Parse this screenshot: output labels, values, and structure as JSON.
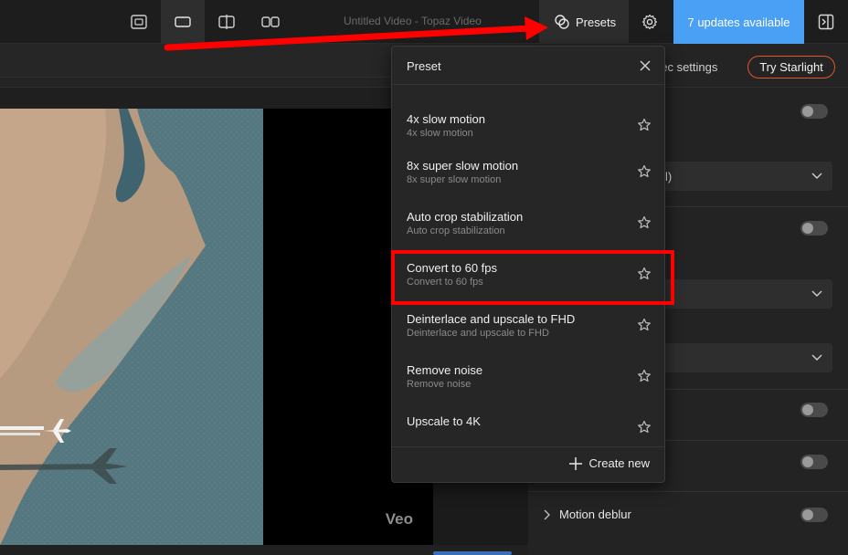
{
  "topbar": {
    "view_buttons": [
      {
        "name": "single-view-icon"
      },
      {
        "name": "fit-view-icon"
      },
      {
        "name": "split-view-icon"
      },
      {
        "name": "side-by-side-icon"
      }
    ],
    "window_title": "Untitled Video - Topaz Video",
    "presets_label": "Presets",
    "updates_label": "7 updates available",
    "accent": "#4aa0f5"
  },
  "subbar": {
    "codec_label": "dec settings",
    "starlight_label": "Try Starlight",
    "starlight_border": "#e0552b"
  },
  "preview": {
    "watermark": "Veo"
  },
  "settings": {
    "select_1_value": "l)",
    "motion_deblur_label": "Motion deblur"
  },
  "preset_popup": {
    "title": "Preset",
    "items": [
      {
        "title": "4x slow motion",
        "subtitle": "4x slow motion"
      },
      {
        "title": "8x super slow motion",
        "subtitle": "8x super slow motion"
      },
      {
        "title": "Auto crop stabilization",
        "subtitle": "Auto crop stabilization"
      },
      {
        "title": "Convert to 60 fps",
        "subtitle": "Convert to 60 fps"
      },
      {
        "title": "Deinterlace and upscale to FHD",
        "subtitle": "Deinterlace and upscale to FHD"
      },
      {
        "title": "Remove noise",
        "subtitle": "Remove noise"
      },
      {
        "title": "Upscale to 4K",
        "subtitle": ""
      }
    ],
    "create_label": "Create new"
  },
  "annotation": {
    "color": "#ff0000",
    "highlighted_item": "Convert to 60 fps"
  }
}
